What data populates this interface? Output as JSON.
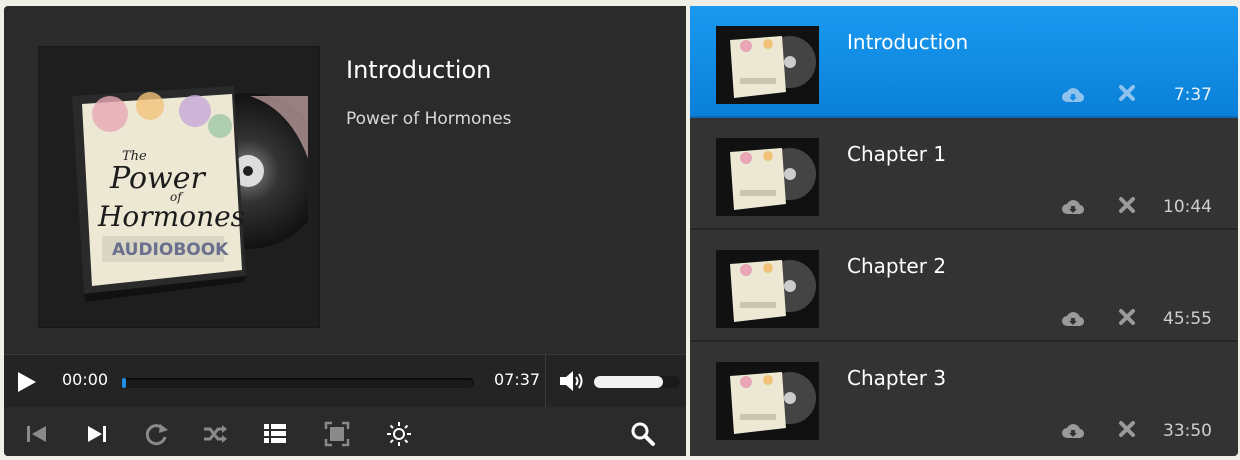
{
  "now_playing": {
    "title": "Introduction",
    "artist": "Power of Hormones",
    "album_art_lettering": [
      "The",
      "Power",
      "of",
      "Hormones",
      "AUDIOBOOK"
    ]
  },
  "controls": {
    "current_time": "00:00",
    "duration": "07:37",
    "progress_fraction": 0.01,
    "volume_fraction": 0.8
  },
  "toolbar": {
    "icons": [
      "skip-back-icon",
      "skip-forward-icon",
      "repeat-icon",
      "shuffle-icon",
      "playlist-icon",
      "fullscreen-icon",
      "brightness-icon",
      "search-icon"
    ]
  },
  "playlist": {
    "items": [
      {
        "title": "Introduction",
        "duration": "7:37",
        "active": true
      },
      {
        "title": "Chapter 1",
        "duration": "10:44",
        "active": false
      },
      {
        "title": "Chapter 2",
        "duration": "45:55",
        "active": false
      },
      {
        "title": "Chapter 3",
        "duration": "33:50",
        "active": false
      }
    ]
  },
  "colors": {
    "accent": "#1a8fe8",
    "panel": "#2b2b2b",
    "playlist_bg": "#333333",
    "icon_gray": "#8a8a8a"
  }
}
